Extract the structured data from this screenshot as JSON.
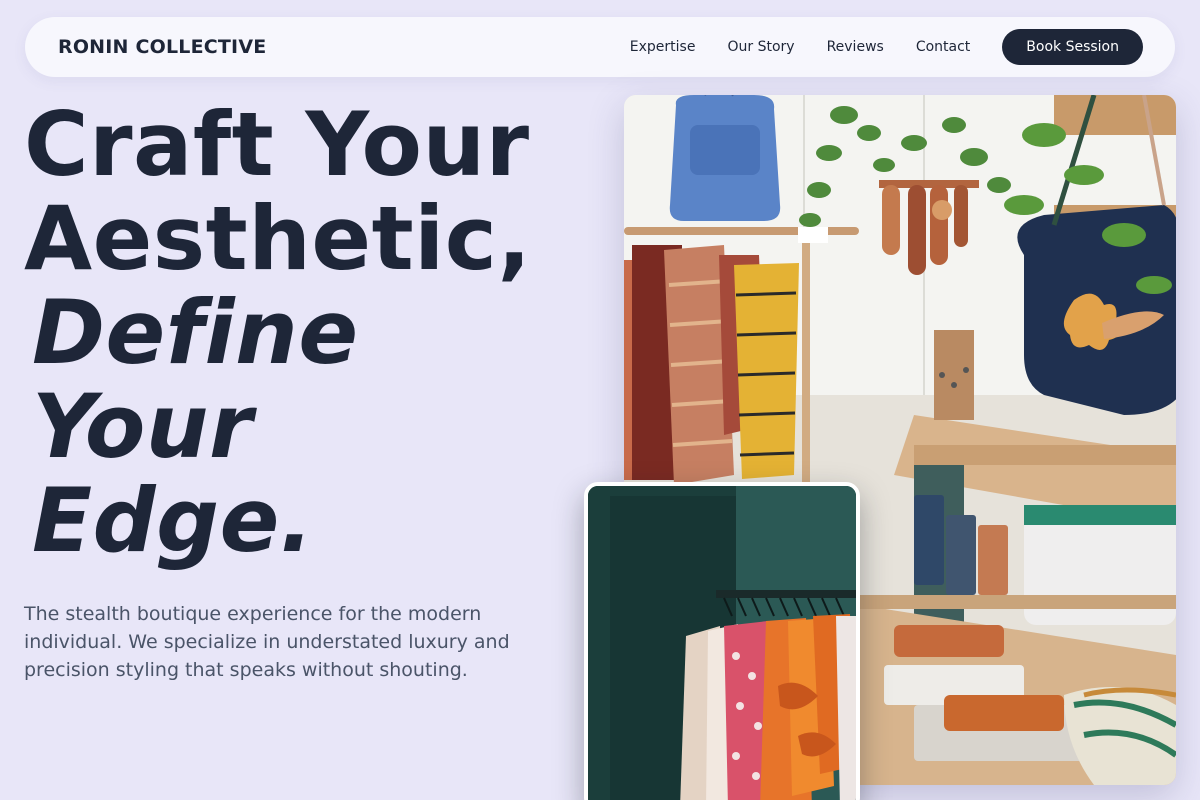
{
  "nav": {
    "brand": "RONIN COLLECTIVE",
    "links": [
      {
        "label": "Expertise"
      },
      {
        "label": "Our Story"
      },
      {
        "label": "Reviews"
      },
      {
        "label": "Contact"
      }
    ],
    "cta": "Book Session"
  },
  "hero": {
    "headline": {
      "line1": "Craft Your",
      "line2": "Aesthetic,",
      "line3": "Define",
      "line4": "Your",
      "line5": "Edge."
    },
    "lead": "The stealth boutique experience for the modern individual. We specialize in understated luxury and precision styling that speaks without shouting."
  },
  "colors": {
    "background": "#e8e6f8",
    "ink": "#1e2638",
    "nav_bg": "#f7f7fd",
    "muted": "#4a5468"
  },
  "images": {
    "main": "boutique-interior-photo",
    "secondary": "clothing-rack-photo"
  }
}
